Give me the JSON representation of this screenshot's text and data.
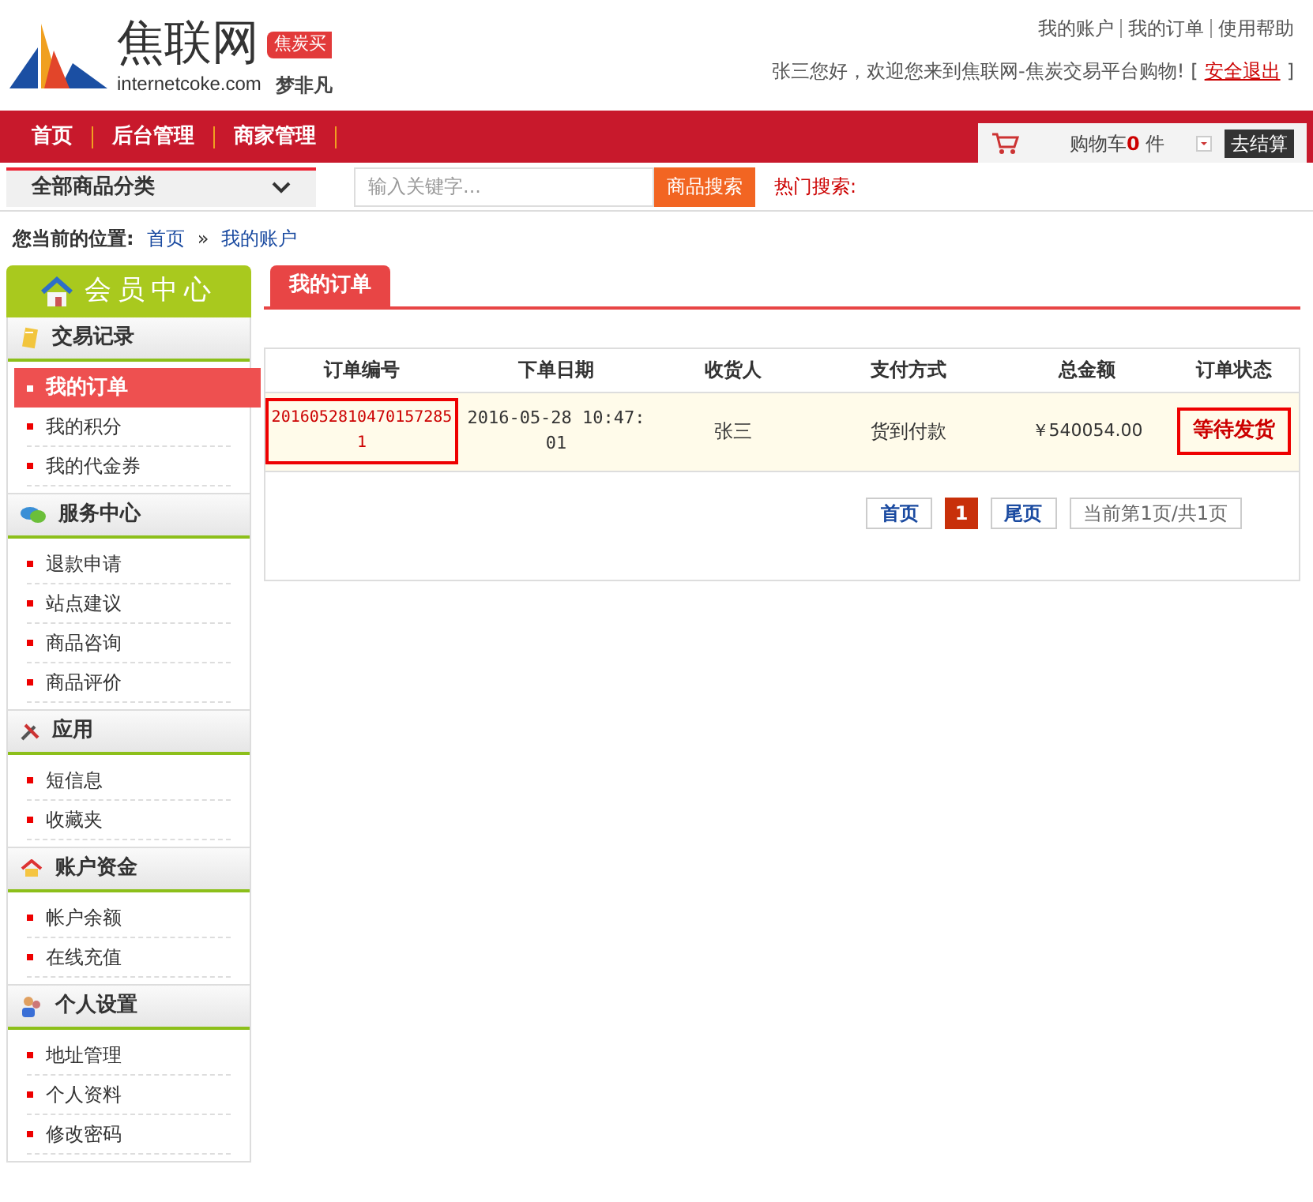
{
  "logo": {
    "name": "焦联网",
    "domain": "internetcoke.com",
    "tag": "焦炭买",
    "slogan": "梦非凡"
  },
  "top_links": [
    "我的账户",
    "我的订单",
    "使用帮助"
  ],
  "welcome": {
    "text": "张三您好，欢迎您来到焦联网-焦炭交易平台购物!",
    "bracket_open": "[",
    "logout": "安全退出",
    "bracket_close": "]"
  },
  "nav": [
    "首页",
    "后台管理",
    "商家管理"
  ],
  "cart": {
    "label": "购物车",
    "count": "0",
    "unit": "件",
    "checkout": "去结算"
  },
  "category": "全部商品分类",
  "search": {
    "placeholder": "输入关键字...",
    "button": "商品搜索",
    "hot": "热门搜索:"
  },
  "breadcrumb": {
    "label": "您当前的位置:",
    "items": [
      "首页",
      "我的账户"
    ],
    "sep": "»"
  },
  "sidebar": {
    "title": "会员中心",
    "sections": [
      {
        "title": "交易记录",
        "kind": "records",
        "items": [
          {
            "label": "我的订单",
            "selected": true
          },
          {
            "label": "我的积分",
            "selected": false
          },
          {
            "label": "我的代金券",
            "selected": false
          }
        ]
      },
      {
        "title": "服务中心",
        "kind": "service",
        "items": [
          {
            "label": "退款申请",
            "selected": false
          },
          {
            "label": "站点建议",
            "selected": false
          },
          {
            "label": "商品咨询",
            "selected": false
          },
          {
            "label": "商品评价",
            "selected": false
          }
        ]
      },
      {
        "title": "应用",
        "kind": "apps",
        "items": [
          {
            "label": "短信息",
            "selected": false
          },
          {
            "label": "收藏夹",
            "selected": false
          }
        ]
      },
      {
        "title": "账户资金",
        "kind": "funds",
        "items": [
          {
            "label": "帐户余额",
            "selected": false
          },
          {
            "label": "在线充值",
            "selected": false
          }
        ]
      },
      {
        "title": "个人设置",
        "kind": "personal",
        "items": [
          {
            "label": "地址管理",
            "selected": false
          },
          {
            "label": "个人资料",
            "selected": false
          },
          {
            "label": "修改密码",
            "selected": false
          }
        ]
      }
    ]
  },
  "tab": "我的订单",
  "table": {
    "columns": [
      "订单编号",
      "下单日期",
      "收货人",
      "支付方式",
      "总金额",
      "订单状态"
    ],
    "rows": [
      {
        "order_no": "20160528104701572851",
        "date": "2016-05-28 10:47:01",
        "receiver": "张三",
        "payment": "货到付款",
        "total": "￥540054.00",
        "status": "等待发货"
      }
    ]
  },
  "pagination": {
    "pages": [
      {
        "label": "首页",
        "kind": "link",
        "selected": false
      },
      {
        "label": "1",
        "kind": "page",
        "selected": true
      },
      {
        "label": "尾页",
        "kind": "link",
        "selected": false
      }
    ],
    "info": "当前第1页/共1页"
  }
}
